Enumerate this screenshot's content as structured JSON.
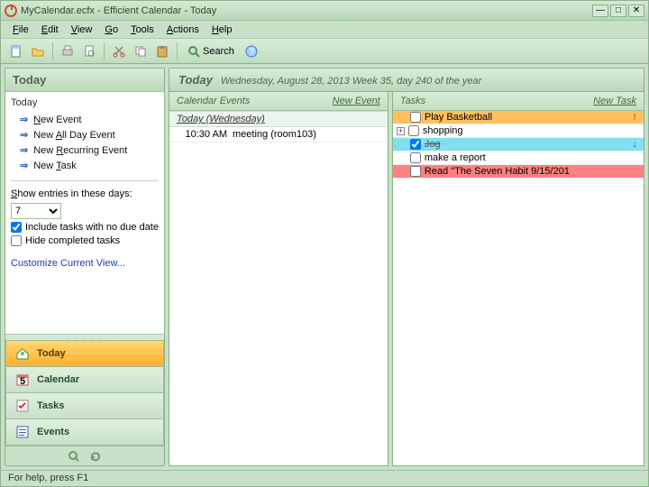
{
  "window": {
    "title": "MyCalendar.ecfx - Efficient Calendar - Today"
  },
  "menubar": [
    "File",
    "Edit",
    "View",
    "Go",
    "Tools",
    "Actions",
    "Help"
  ],
  "toolbar": {
    "icons": [
      "new-doc",
      "open",
      "print",
      "print-preview",
      "cut",
      "copy",
      "paste"
    ],
    "search_label": "Search"
  },
  "sidebar": {
    "header": "Today",
    "group_label": "Today",
    "links": [
      {
        "label": "New Event",
        "u": "N"
      },
      {
        "label": "New All Day Event",
        "u": "A"
      },
      {
        "label": "New Recurring Event",
        "u": "R"
      },
      {
        "label": "New Task",
        "u": "T"
      }
    ],
    "show_entries_label": "Show entries in these days:",
    "days_value": "7",
    "include_nodue_label": "Include tasks with no due date",
    "include_nodue_checked": true,
    "hide_completed_label": "Hide completed tasks",
    "hide_completed_checked": false,
    "customize_label": "Customize Current View..."
  },
  "nav": [
    {
      "label": "Today",
      "icon": "home",
      "active": true
    },
    {
      "label": "Calendar",
      "icon": "calendar",
      "active": false
    },
    {
      "label": "Tasks",
      "icon": "tasks",
      "active": false
    },
    {
      "label": "Events",
      "icon": "events",
      "active": false
    }
  ],
  "content": {
    "title_bold": "Today",
    "title_rest": "Wednesday, August 28, 2013  Week 35, day 240 of the year"
  },
  "events_pane": {
    "header": "Calendar  Events",
    "newlink": "New Event",
    "day_label": "Today (Wednesday)",
    "rows": [
      {
        "time": "10:30 AM",
        "title": "meeting (room103)"
      }
    ]
  },
  "tasks_pane": {
    "header": "Tasks",
    "newlink": "New Task",
    "rows": [
      {
        "title": "Play Basketball",
        "checked": false,
        "expander": "",
        "hl": "orange",
        "flag": "!",
        "flagc": "red",
        "done": false
      },
      {
        "title": "shopping",
        "checked": false,
        "expander": "+",
        "hl": "",
        "flag": "",
        "flagc": "",
        "done": false
      },
      {
        "title": "Jog",
        "checked": true,
        "expander": "",
        "hl": "cyan",
        "flag": "↓",
        "flagc": "blue",
        "done": true
      },
      {
        "title": "make a report",
        "checked": false,
        "expander": "",
        "hl": "",
        "flag": "",
        "flagc": "",
        "done": false
      },
      {
        "title": "Read \"The Seven Habit 9/15/201",
        "checked": false,
        "expander": "",
        "hl": "red",
        "flag": "",
        "flagc": "",
        "done": false
      }
    ]
  },
  "statusbar": "For help, press F1"
}
